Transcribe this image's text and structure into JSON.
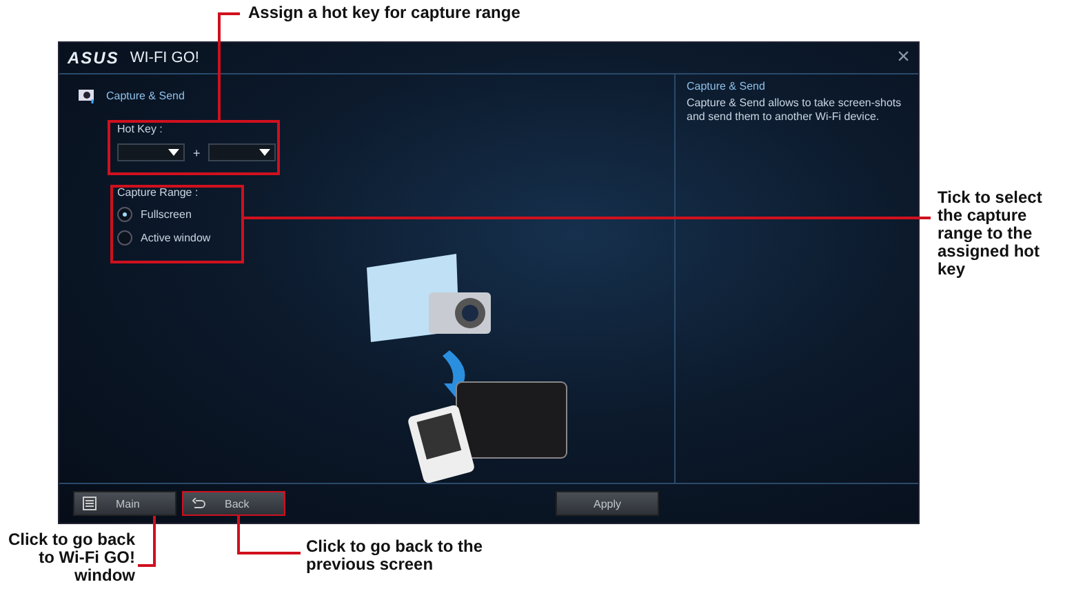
{
  "annotations": {
    "top": "Assign a hot key for capture range",
    "right": "Tick to select the capture range to the assigned hot key",
    "bottom_left": "Click to go back to Wi-Fi GO! window",
    "bottom_middle": "Click to go back to the previous screen"
  },
  "window": {
    "logo": "ASUS",
    "title": "WI-FI GO!",
    "close": "×"
  },
  "section": {
    "title": "Capture & Send"
  },
  "hot_key": {
    "label": "Hot Key :",
    "separator": "+"
  },
  "capture_range": {
    "label": "Capture Range :",
    "options": [
      {
        "label": "Fullscreen",
        "selected": true
      },
      {
        "label": "Active window",
        "selected": false
      }
    ]
  },
  "info": {
    "title": "Capture & Send",
    "text": "Capture & Send allows to take screen-shots and send them to another Wi-Fi device."
  },
  "buttons": {
    "main": "Main",
    "back": "Back",
    "apply": "Apply"
  }
}
